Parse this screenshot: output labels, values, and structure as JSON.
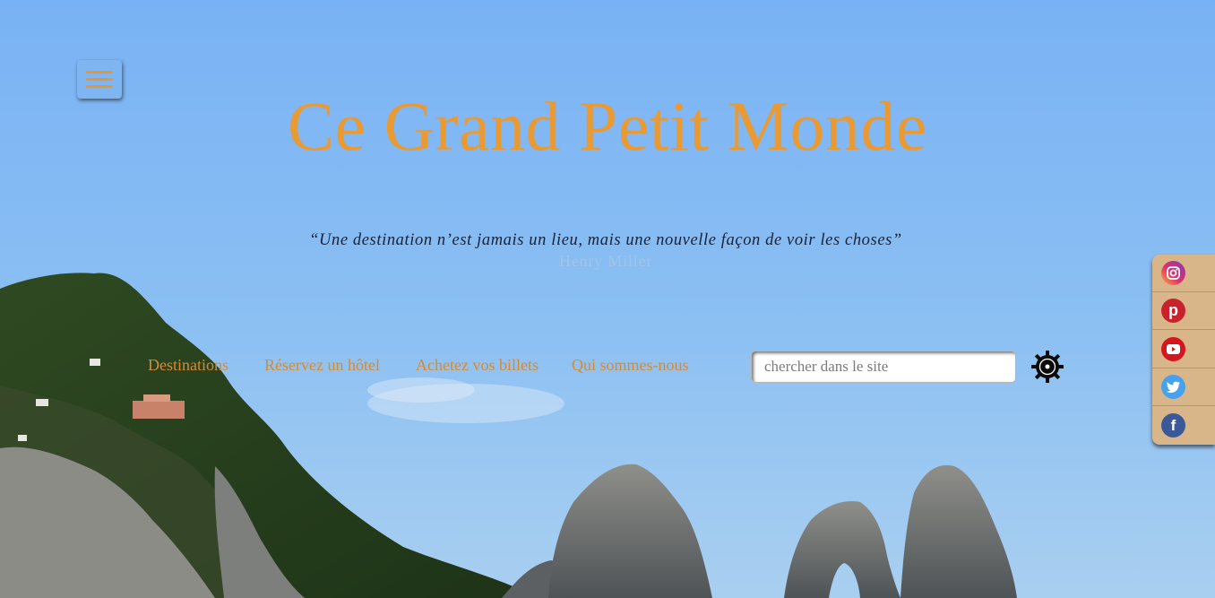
{
  "header": {
    "title": "Ce Grand Petit Monde",
    "quote": "“Une destination n’est jamais un lieu, mais une nouvelle façon de voir les choses”",
    "author": "Henry Miller"
  },
  "menu": {
    "icon": "hamburger-menu-icon"
  },
  "nav": {
    "items": [
      {
        "label": "Destinations"
      },
      {
        "label": "Réservez un hôtel"
      },
      {
        "label": "Achetez vos billets"
      },
      {
        "label": "Qui sommes-nous"
      }
    ]
  },
  "search": {
    "placeholder": "chercher dans le site",
    "value": "",
    "icon": "ship-wheel-search-icon"
  },
  "social": {
    "items": [
      {
        "name": "instagram",
        "icon": "instagram-icon"
      },
      {
        "name": "pinterest",
        "icon": "pinterest-icon",
        "glyph": "p"
      },
      {
        "name": "youtube",
        "icon": "youtube-icon"
      },
      {
        "name": "twitter",
        "icon": "twitter-icon"
      },
      {
        "name": "facebook",
        "icon": "facebook-icon",
        "glyph": "f"
      }
    ]
  },
  "colors": {
    "sky": "#7fb6f5",
    "accent": "#ea9a33",
    "nav": "#d88a30",
    "social_bg": "#d9b68a",
    "instagram": "#c13584",
    "pinterest": "#c8232c",
    "youtube": "#d5161f",
    "twitter": "#48a1ec",
    "facebook": "#3b5998"
  }
}
